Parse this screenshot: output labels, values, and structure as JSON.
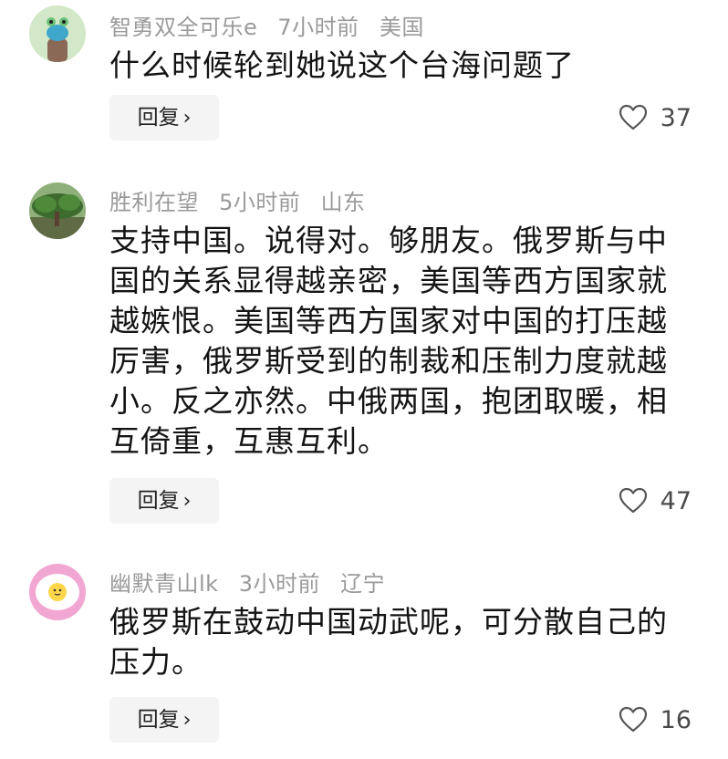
{
  "comments": [
    {
      "username": "智勇双全可乐e",
      "time": "7小时前",
      "location": "美国",
      "text": "什么时候轮到她说这个台海问题了",
      "reply_label": "回复",
      "likes": "37",
      "avatar_icon": "cartoon-figure-avatar"
    },
    {
      "username": "胜利在望",
      "time": "5小时前",
      "location": "山东",
      "text": "支持中国。说得对。够朋友。俄罗斯与中国的关系显得越亲密，美国等西方国家就越嫉恨。美国等西方国家对中国的打压越厉害，俄罗斯受到的制裁和压制力度就越小。反之亦然。中俄两国，抱团取暖，相互倚重，互惠互利。",
      "reply_label": "回复",
      "likes": "47",
      "avatar_icon": "tree-landscape-avatar"
    },
    {
      "username": "幽默青山lk",
      "time": "3小时前",
      "location": "辽宁",
      "text": "俄罗斯在鼓动中国动武呢，可分散自己的压力。",
      "reply_label": "回复",
      "likes": "16",
      "avatar_icon": "fried-egg-avatar"
    }
  ],
  "colors": {
    "meta": "#9a9a9a",
    "reply_bg": "#f4f4f4",
    "text": "#141414"
  }
}
